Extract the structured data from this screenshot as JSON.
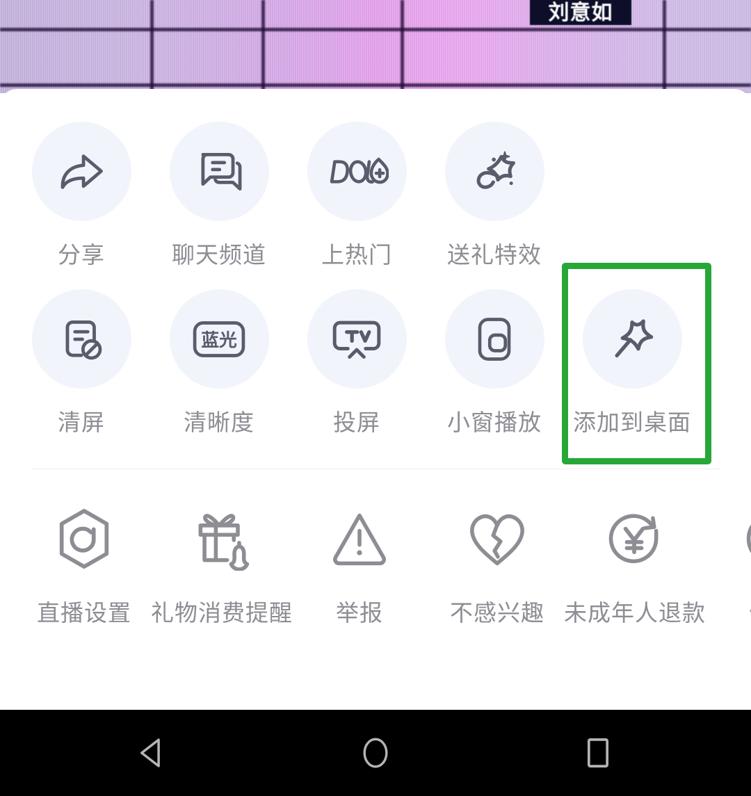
{
  "background": {
    "name_badge": "刘意如"
  },
  "sheet": {
    "primary_rows": [
      [
        {
          "label": "分享",
          "icon": "share-arrow-icon"
        },
        {
          "label": "聊天频道",
          "icon": "chat-bubbles-icon"
        },
        {
          "label": "上热门",
          "icon": "dou-plus-icon"
        },
        {
          "label": "送礼特效",
          "icon": "gift-effect-star-icon"
        }
      ],
      [
        {
          "label": "清屏",
          "icon": "clear-screen-icon"
        },
        {
          "label": "清晰度",
          "icon": "bluray-quality-icon",
          "icon_text": "蓝光"
        },
        {
          "label": "投屏",
          "icon": "tv-cast-icon",
          "icon_text": "TV"
        },
        {
          "label": "小窗播放",
          "icon": "picture-in-picture-icon"
        },
        {
          "label": "添加到桌面",
          "icon": "pushpin-icon",
          "highlighted": true
        }
      ]
    ],
    "secondary_row": [
      {
        "label": "直播设置",
        "icon": "hexagon-settings-icon"
      },
      {
        "label": "礼物消费提醒",
        "icon": "gift-bell-reminder-icon"
      },
      {
        "label": "举报",
        "icon": "warning-triangle-icon"
      },
      {
        "label": "不感兴趣",
        "icon": "broken-heart-icon"
      },
      {
        "label": "未成年人退款",
        "icon": "yuan-refund-icon"
      },
      {
        "label": "优化",
        "icon": "partial-circle-icon"
      }
    ]
  },
  "highlight": {
    "color": "#27a737",
    "target_label": "添加到桌面"
  },
  "navbar": {
    "back": "back-triangle-icon",
    "home": "home-circle-icon",
    "recents": "recents-square-icon"
  },
  "colors": {
    "circle_bg": "#f1f4fb",
    "icon_stroke": "#585c6b",
    "label_text": "#8d8d94",
    "secondary_icon_stroke": "#8d8d94",
    "sheet_bg": "#ffffff",
    "navbar_bg": "#000000"
  }
}
